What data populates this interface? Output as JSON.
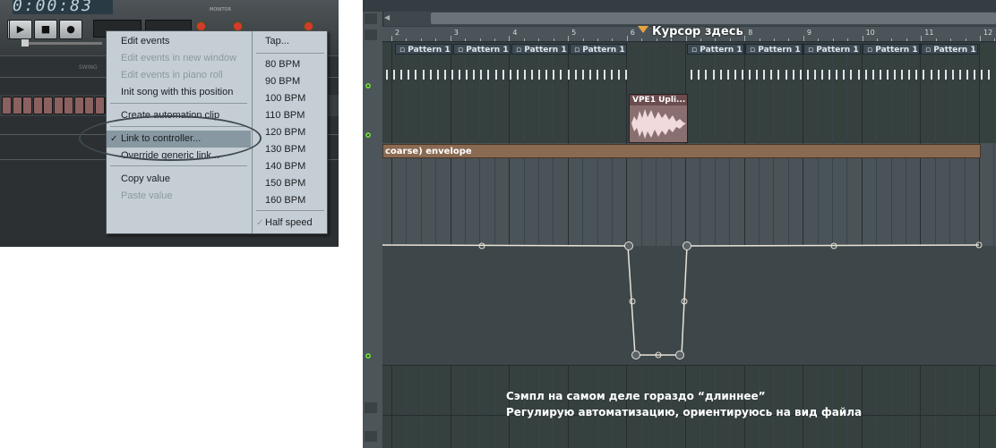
{
  "transport": {
    "time": "0:00:83",
    "monitor_label": "MONITOR",
    "swing_label": "SWING"
  },
  "context_menu": {
    "items": [
      {
        "label": "Edit events",
        "enabled": true,
        "checked": false,
        "highlighted": false
      },
      {
        "label": "Edit events in new window",
        "enabled": false,
        "checked": false,
        "highlighted": false
      },
      {
        "label": "Edit events in piano roll",
        "enabled": false,
        "checked": false,
        "highlighted": false
      },
      {
        "label": "Init song with this position",
        "enabled": true,
        "checked": false,
        "highlighted": false
      },
      {
        "label": "Create automation clip",
        "enabled": true,
        "checked": false,
        "highlighted": false
      },
      {
        "label": "Link to controller...",
        "enabled": true,
        "checked": true,
        "highlighted": true
      },
      {
        "label": "Override generic link...",
        "enabled": true,
        "checked": false,
        "highlighted": false
      },
      {
        "label": "Copy value",
        "enabled": true,
        "checked": false,
        "highlighted": false
      },
      {
        "label": "Paste value",
        "enabled": false,
        "checked": false,
        "highlighted": false
      }
    ],
    "tempo_items": [
      {
        "label": "Tap..."
      },
      {
        "label": "80 BPM"
      },
      {
        "label": "90 BPM"
      },
      {
        "label": "100 BPM"
      },
      {
        "label": "110 BPM"
      },
      {
        "label": "120 BPM"
      },
      {
        "label": "130 BPM"
      },
      {
        "label": "140 BPM"
      },
      {
        "label": "150 BPM"
      },
      {
        "label": "160 BPM"
      },
      {
        "label": "Half speed",
        "checked": true
      }
    ]
  },
  "playlist": {
    "cursor_label": "Курсор здесь",
    "ruler": [
      "2",
      "3",
      "4",
      "5",
      "6",
      "7",
      "8",
      "9",
      "10",
      "11",
      "12"
    ],
    "pattern_label": "Pattern 1",
    "clip_label": "VPE1 Upli...",
    "envelope_label": "coarse) envelope",
    "notes": [
      "Сэмпл на самом деле гораздо “длиннее”",
      "Регулирую автоматизацию, ориентируюсь на вид файла"
    ]
  },
  "colors": {
    "cursor_marker": "#e8a33d",
    "menu_bg": "#c5ced4",
    "envelope": "#8a6a52",
    "clip": "#8a6f70",
    "led": "#6ccf3c"
  }
}
